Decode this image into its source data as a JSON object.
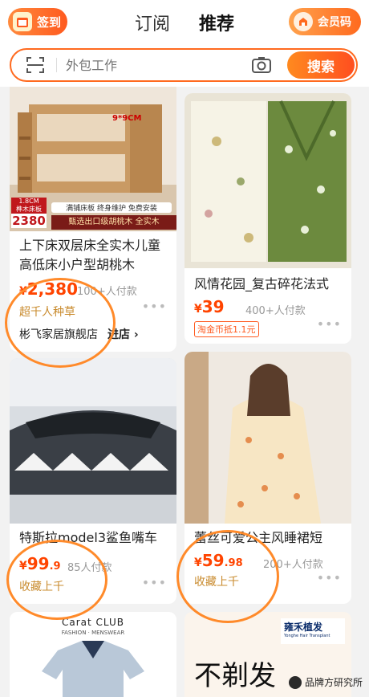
{
  "header": {
    "checkin_label": "签到",
    "tabs": [
      {
        "label": "订阅"
      },
      {
        "label": "推荐"
      }
    ],
    "member_label": "会员码"
  },
  "search": {
    "placeholder": "外包工作",
    "button": "搜索"
  },
  "cards": {
    "bed": {
      "overlay_tag": "1.8CM\n榫木床板",
      "overlay_price": "2380",
      "overlay_features": "满铺床板 终身维护 免费安装",
      "overlay_line": "甄选出口级胡桃木 全实木",
      "dimension": "9*9CM",
      "title": "上下床双层床全实木儿童高低床小户型胡桃木",
      "price_cur": "¥",
      "price_main": "2,380",
      "sold": "100+人付款",
      "tag": "超千人种草",
      "shop": "彬飞家居旗舰店",
      "shop_link": "进店 ›"
    },
    "blouse": {
      "title": "风情花园_复古碎花法式",
      "price_cur": "¥",
      "price_main": "39",
      "sold": "400+人付款",
      "badge": "淘金币抵1.1元"
    },
    "car": {
      "title": "特斯拉model3鲨鱼嘴车",
      "price_cur": "¥",
      "price_main": "99",
      "price_dec": ".9",
      "sold": "85人付款",
      "tag": "收藏上千"
    },
    "dress": {
      "title": "蕾丝可爱公主风睡裙短",
      "price_cur": "¥",
      "price_main": "59",
      "price_dec": ".98",
      "sold": "200+人付款",
      "tag": "收藏上千"
    },
    "shirt": {
      "brand": "Carat CLUB",
      "brand_sub": "FASHION · MENSWEAR"
    },
    "hair": {
      "brand": "雍禾植发",
      "brand_sub": "Yonghe Hair Transplant",
      "headline": "不剃发"
    }
  },
  "watermark": "品牌方研究所",
  "colors": {
    "accent": "#ff5a1f",
    "price": "#ff4400",
    "annotation": "#ff8a2a"
  }
}
